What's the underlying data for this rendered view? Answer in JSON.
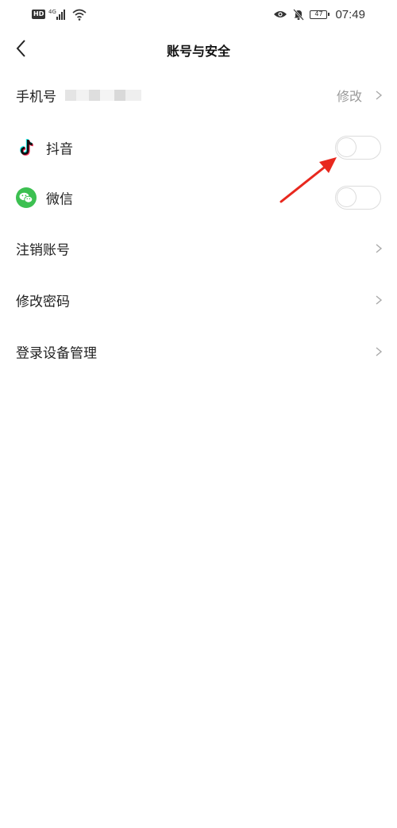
{
  "status_bar": {
    "left_badge": "HD",
    "network": "4G",
    "battery_level": "47",
    "time": "07:49",
    "icons": [
      "hd-icon",
      "signal-icon",
      "wifi-icon",
      "eye-icon",
      "mute-bell-icon",
      "battery-icon"
    ]
  },
  "header": {
    "title": "账号与安全",
    "back_icon": "chevron-left-icon"
  },
  "rows": {
    "phone": {
      "label": "手机号",
      "action": "修改",
      "value_masked": true
    },
    "douyin": {
      "label": "抖音",
      "icon": "douyin-icon",
      "toggle_on": false
    },
    "wechat": {
      "label": "微信",
      "icon": "wechat-icon",
      "toggle_on": false
    },
    "cancel_account": {
      "label": "注销账号"
    },
    "change_password": {
      "label": "修改密码"
    },
    "device_management": {
      "label": "登录设备管理"
    }
  },
  "colors": {
    "text": "#222222",
    "muted": "#9a9a9a",
    "toggle_border": "#dcdcdc",
    "wechat_green": "#3cc051",
    "annotation_red": "#e8281e"
  }
}
